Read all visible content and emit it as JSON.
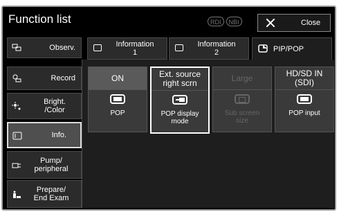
{
  "window": {
    "title": "Function list",
    "close_label": "Close",
    "badges": [
      "RDI",
      "NBI"
    ]
  },
  "sidebar": {
    "items": [
      {
        "label": "Observ.",
        "icon": "observation-icon"
      },
      {
        "label": "Record",
        "icon": "record-icon"
      },
      {
        "label": "Bright.\n/Color",
        "icon": "brightness-icon"
      },
      {
        "label": "Info.",
        "icon": "info-icon",
        "active": true
      },
      {
        "label": "Pump/\nperipheral",
        "icon": "pump-icon"
      },
      {
        "label": "Prepare/\nEnd Exam",
        "icon": "prepare-icon"
      }
    ]
  },
  "tabs": [
    {
      "label": "Information\n1"
    },
    {
      "label": "Information\n2"
    },
    {
      "label": "PIP/POP",
      "active": true
    }
  ],
  "options": [
    {
      "head": "ON",
      "caption": "POP"
    },
    {
      "head": "Ext. source\nright scrn",
      "caption": "POP display\nmode",
      "selected": true
    },
    {
      "head": "Large",
      "caption": "Sub screen\nsize",
      "disabled": true
    },
    {
      "head": "HD/SD IN\n(SDI)",
      "caption": "POP input"
    }
  ]
}
